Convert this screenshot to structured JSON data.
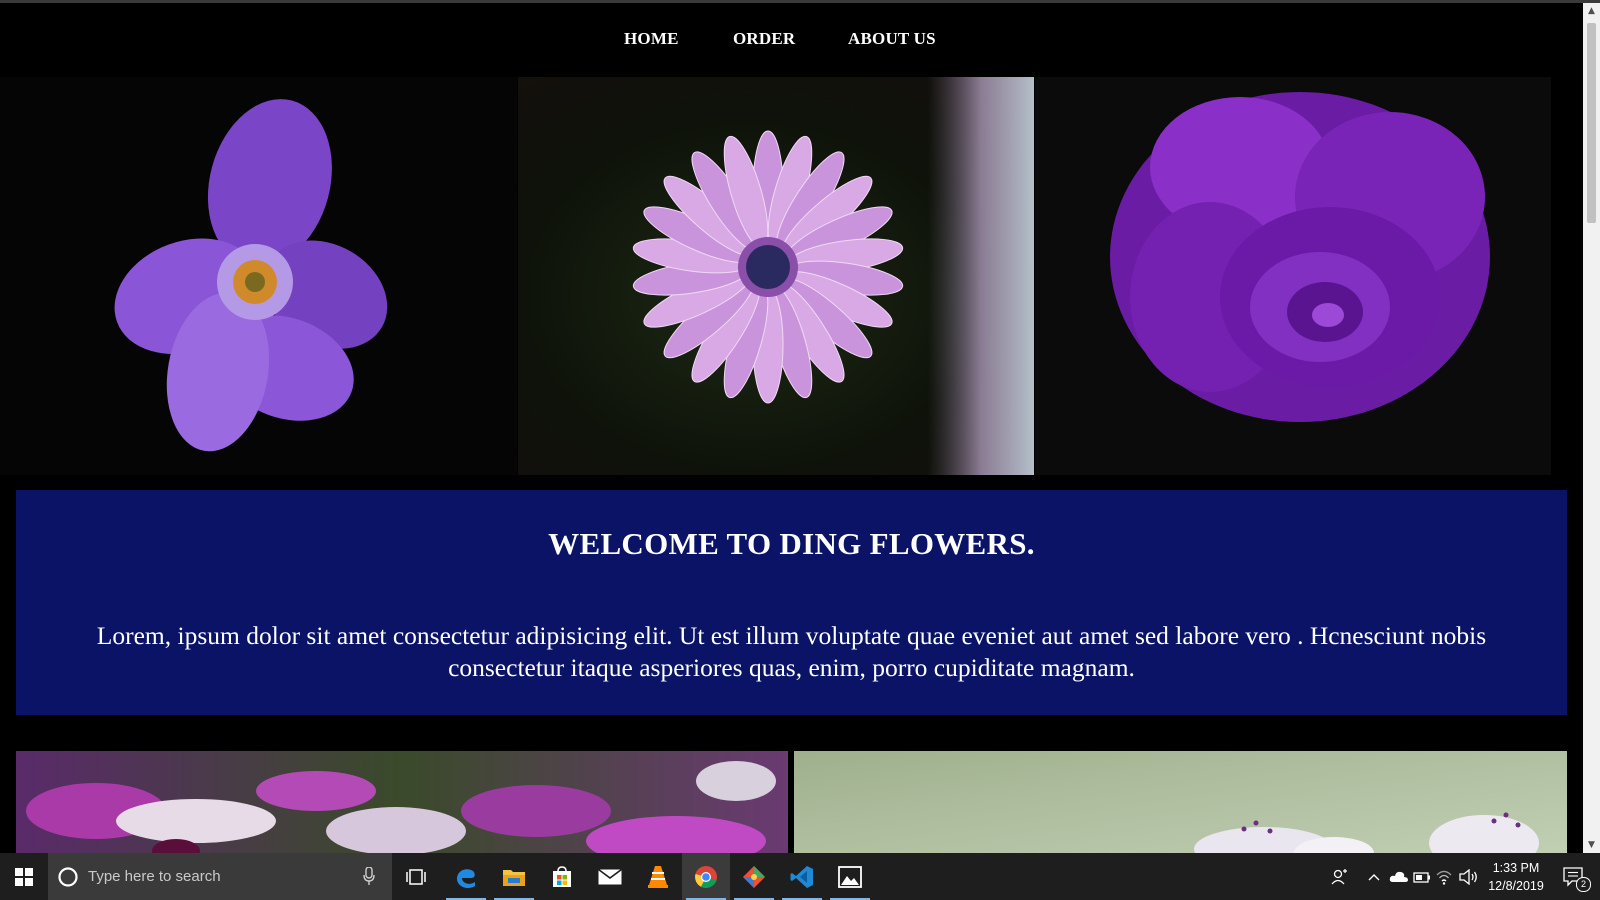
{
  "nav": {
    "items": [
      "HOME",
      "ORDER",
      "ABOUT US"
    ]
  },
  "welcome": {
    "title": "WELCOME TO DING FLOWERS.",
    "body": "Lorem, ipsum dolor sit amet consectetur adipisicing elit. Ut est illum voluptate quae eveniet aut amet sed labore vero . Hcnesciunt nobis consectetur itaque asperiores quas, enim, porro cupiditate magnam."
  },
  "images": [
    "purple-wild-rose",
    "lavender-daisy",
    "purple-rose",
    "purple-daisies-cluster",
    "white-cherry-blossom"
  ],
  "taskbar": {
    "search_placeholder": "Type here to search",
    "apps": [
      "task-view",
      "edge",
      "file-explorer",
      "store",
      "mail",
      "vlc",
      "chrome",
      "git",
      "vscode",
      "photos"
    ],
    "time": "1:33 PM",
    "date": "12/8/2019",
    "notification_count": "2"
  },
  "colors": {
    "banner": "#0a1366",
    "background": "#000000"
  }
}
